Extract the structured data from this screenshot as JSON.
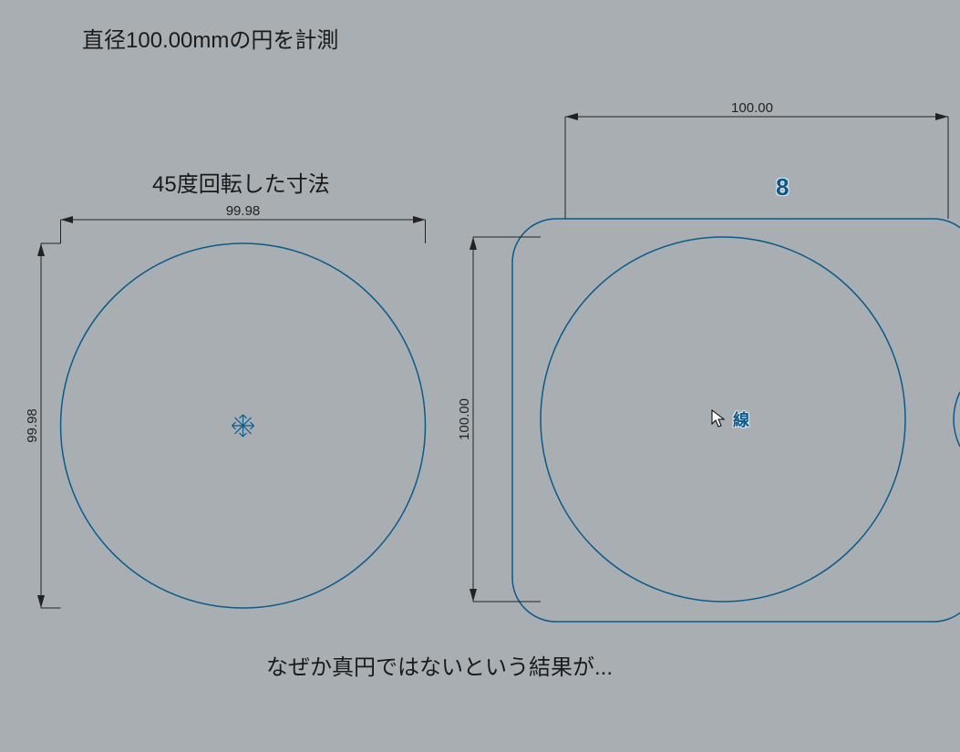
{
  "title": "直径100.00mmの円を計測",
  "left": {
    "subtitle": "45度回転した寸法",
    "dim_h": "99.98",
    "dim_v": "99.98"
  },
  "right": {
    "dim_h": "100.00",
    "dim_v": "100.00",
    "tooltip": "線",
    "marker": "8"
  },
  "footer": "なぜか真円ではないという結果が...",
  "colors": {
    "circle": "#0a5a8a",
    "dim": "#222"
  },
  "chart_data": [
    {
      "type": "diagram",
      "description": "circle with bounding dimensions after 45 degree rotation",
      "width_mm": 99.98,
      "height_mm": 99.98
    },
    {
      "type": "diagram",
      "description": "circle with bounding dimensions and rounded rectangle overlay",
      "width_mm": 100.0,
      "height_mm": 100.0
    }
  ]
}
